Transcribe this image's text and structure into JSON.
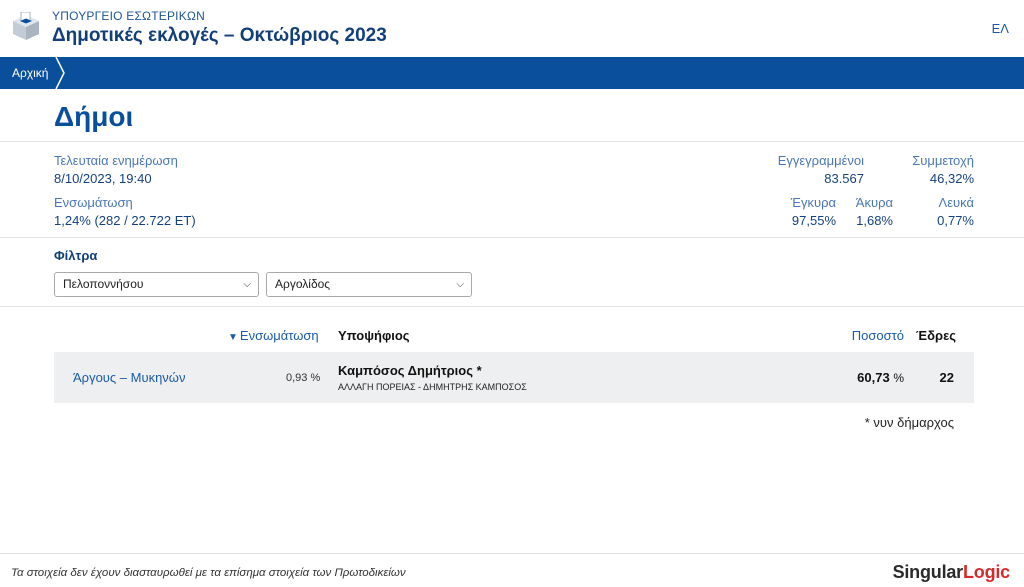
{
  "header": {
    "ministry": "ΥΠΟΥΡΓΕΙΟ ΕΣΩΤΕΡΙΚΩΝ",
    "title": "Δημοτικές εκλογές – Οκτώβριος 2023",
    "lang": "ΕΛ",
    "logo_icon": "ballot-box-icon"
  },
  "nav": {
    "breadcrumb": "Αρχική"
  },
  "page": {
    "title": "Δήμοι"
  },
  "stats": {
    "last_update_label": "Τελευταία ενημέρωση",
    "last_update_value": "8/10/2023, 19:40",
    "integration_label": "Ενσωμάτωση",
    "integration_value": "1,24% (282 / 22.722 ΕΤ)",
    "registered_label": "Εγγεγραμμένοι",
    "registered_value": "83.567",
    "turnout_label": "Συμμετοχή",
    "turnout_value": "46,32%",
    "valid_label": "Έγκυρα",
    "valid_value": "97,55%",
    "invalid_label": "Άκυρα",
    "invalid_value": "1,68%",
    "blank_label": "Λευκά",
    "blank_value": "0,77%"
  },
  "filters": {
    "label": "Φίλτρα",
    "region": "Πελοποννήσου",
    "unit": "Αργολίδος"
  },
  "table": {
    "headers": {
      "integration": "Ενσωμάτωση",
      "candidate": "Υποψήφιος",
      "percent": "Ποσοστό",
      "seats": "Έδρες"
    },
    "rows": [
      {
        "municipality": "Άργους – Μυκηνών",
        "integration": "0,93 %",
        "candidate": "Καμπόσος Δημήτριος *",
        "party": "ΑΛΛΑΓΗ ΠΟΡΕΙΑΣ - ΔΗΜΗΤΡΗΣ ΚΑΜΠΟΣΟΣ",
        "percent": "60,73",
        "percent_unit": "%",
        "seats": "22"
      }
    ]
  },
  "footnote": "* νυν δήμαρχος",
  "footer": {
    "disclaimer": "Τα στοιχεία δεν έχουν διασταυρωθεί με τα επίσημα στοιχεία των Πρωτοδικείων",
    "brand_main": "Singular",
    "brand_accent": "Logic"
  },
  "colors": {
    "primary": "#0a4f9b",
    "accent": "#d62b2b",
    "row_bg": "#eeeff0"
  }
}
